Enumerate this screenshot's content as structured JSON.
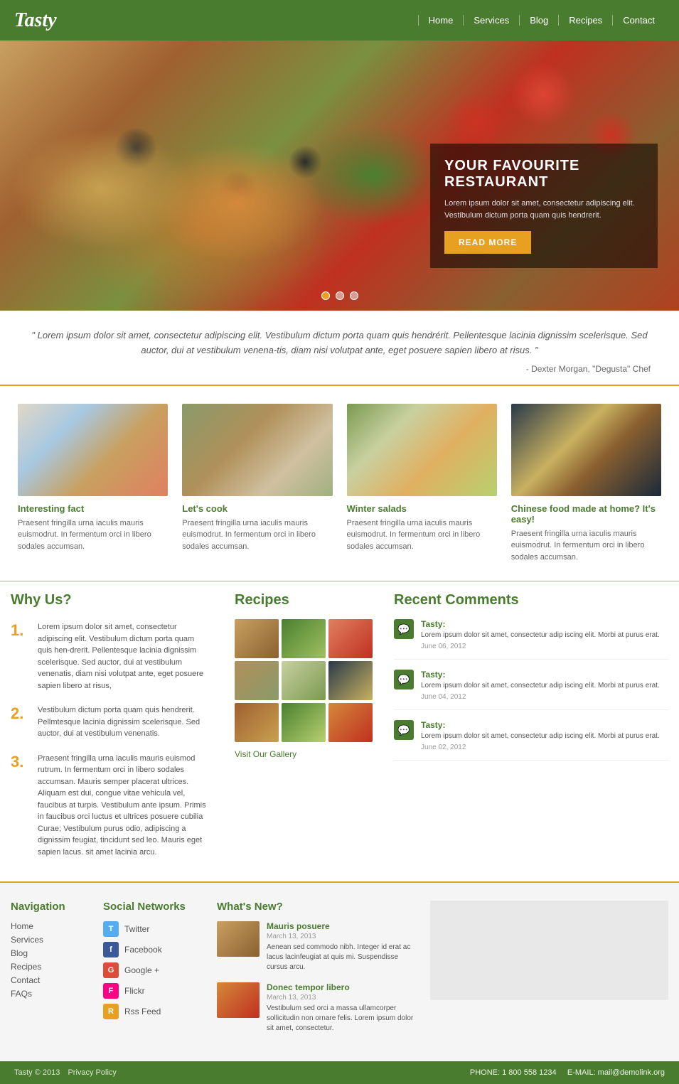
{
  "header": {
    "logo": "Tasty",
    "nav": {
      "items": [
        {
          "label": "Home",
          "href": "#"
        },
        {
          "label": "Services",
          "href": "#"
        },
        {
          "label": "Blog",
          "href": "#"
        },
        {
          "label": "Recipes",
          "href": "#"
        },
        {
          "label": "Contact",
          "href": "#"
        }
      ]
    }
  },
  "hero": {
    "title": "YOUR FAVOURITE RESTAURANT",
    "description": "Lorem ipsum dolor sit amet, consectetur adipiscing elit. Vestibulum dictum porta quam quis hendrerit.",
    "button_label": "READ MORE",
    "dots": [
      "active",
      "",
      ""
    ]
  },
  "quote": {
    "text": "\" Lorem ipsum dolor sit amet, consectetur adipiscing elit. Vestibulum dictum porta quam quis hendrérit. Pellentesque lacinia dignissim scelerisque. Sed auctor, dui at vestibulum venena-tis, diam nisi volutpat ante, eget posuere sapien libero at risus. \"",
    "author": "- Dexter Morgan, \"Degusta\" Chef"
  },
  "food_cards": [
    {
      "title": "Interesting fact",
      "desc": "Praesent fringilla urna iaculis mauris euismodrut. In fermentum orci in libero sodales accumsan."
    },
    {
      "title": "Let's cook",
      "desc": "Praesent fringilla urna iaculis mauris euismodrut. In fermentum orci in libero sodales accumsan."
    },
    {
      "title": "Winter salads",
      "desc": "Praesent fringilla urna iaculis mauris euismodrut. In fermentum orci in libero sodales accumsan."
    },
    {
      "title": "Chinese food made at home? It's easy!",
      "desc": "Praesent fringilla urna iaculis mauris euismodrut. In fermentum orci in libero sodales accumsan."
    }
  ],
  "why_us": {
    "title": "Why Us?",
    "items": [
      {
        "number": "1.",
        "text": "Lorem ipsum dolor sit amet, consectetur adipiscing elit. Vestibulum dictum porta quam quis hen-drerit. Pellentesque lacinia dignissim scelerisque. Sed auctor, dui at vestibulum venenatis, diam nisi volutpat ante, eget posuere sapien libero at risus,"
      },
      {
        "number": "2.",
        "text": "Vestibulum dictum porta quam quis hendrerit. Pellmtesque lacinia dignissim scelerisque. Sed auctor, dui at vestibulum venenatis."
      },
      {
        "number": "3.",
        "text": "Praesent fringilla urna iaculis mauris euismod rutrum. In fermentum orci in libero sodales accumsan. Mauris semper placerat ultrices. Aliquam est dui, congue vitae vehicula vel, faucibus at turpis. Vestibulum ante ipsum. Primis in faucibus orci luctus et ultrices posuere cubilia Curae; Vestibulum purus odio, adipiscing a dignissim feugiat, tincidunt sed leo. Mauris eget sapien lacus. sit amet lacinia arcu."
      }
    ]
  },
  "recipes": {
    "title": "Recipes",
    "visit_gallery_label": "Visit Our Gallery"
  },
  "recent_comments": {
    "title": "Recent Comments",
    "items": [
      {
        "author": "Tasty:",
        "text": "Lorem ipsum dolor sit amet, consectetur adip iscing elit. Morbi at purus erat.",
        "date": "June 06, 2012"
      },
      {
        "author": "Tasty:",
        "text": "Lorem ipsum dolor sit amet, consectetur adip iscing elit. Morbi at purus erat.",
        "date": "June 04, 2012"
      },
      {
        "author": "Tasty:",
        "text": "Lorem ipsum dolor sit amet, consectetur adip iscing elit. Morbi at purus erat.",
        "date": "June 02, 2012"
      }
    ]
  },
  "footer": {
    "navigation": {
      "title": "Navigation",
      "links": [
        {
          "label": "Home"
        },
        {
          "label": "Services"
        },
        {
          "label": "Blog"
        },
        {
          "label": "Recipes"
        },
        {
          "label": "Contact"
        },
        {
          "label": "FAQs"
        }
      ]
    },
    "social_networks": {
      "title": "Social Networks",
      "items": [
        {
          "label": "Twitter",
          "icon": "T",
          "type": "twitter"
        },
        {
          "label": "Facebook",
          "icon": "f",
          "type": "facebook"
        },
        {
          "label": "Google +",
          "icon": "G",
          "type": "google"
        },
        {
          "label": "Flickr",
          "icon": "F",
          "type": "flickr"
        },
        {
          "label": "Rss Feed",
          "icon": "R",
          "type": "rss"
        }
      ]
    },
    "whats_new": {
      "title": "What's New?",
      "items": [
        {
          "title": "Mauris posuere",
          "date": "March 13, 2013",
          "desc": "Aenean sed commodo nibh. Integer id erat ac lacus lacinfeugiat at quis mi. Suspendisse cursus arcu."
        },
        {
          "title": "Donec tempor libero",
          "date": "March 13, 2013",
          "desc": "Vestibulum sed orci a massa ullamcorper sollicitudin non ornare felis. Lorem ipsum dolor sit amet, consectetur."
        }
      ]
    },
    "copyright": "Tasty © 2013",
    "privacy_policy": "Privacy Policy",
    "phone": "PHONE: 1 800 558 1234",
    "email": "E-MAIL: mail@demolink.org"
  }
}
